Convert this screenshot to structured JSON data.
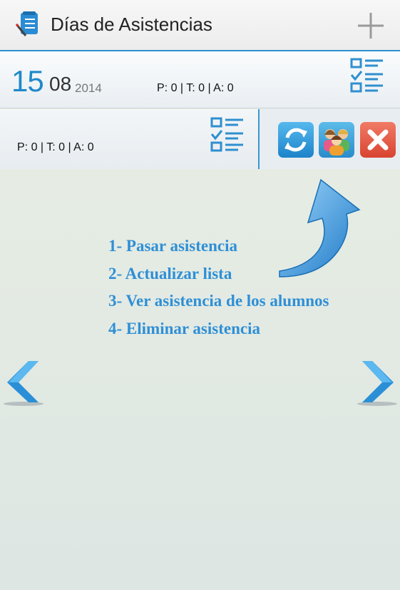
{
  "app": {
    "title": "Días de Asistencias"
  },
  "icons": {
    "app": "checklist-notepad-icon",
    "add": "plus-icon",
    "list": "checklist-icon",
    "refresh": "refresh-icon",
    "students": "students-group-icon",
    "delete": "close-icon",
    "prev": "chevron-left-icon",
    "next": "chevron-right-icon",
    "pointer": "curved-arrow-icon"
  },
  "attendance_days": [
    {
      "day": "15",
      "month": "08",
      "year": "2014",
      "stats": "P: 0 | T: 0 | A: 0"
    },
    {
      "stats": "P: 0 | T: 0 | A: 0"
    }
  ],
  "instructions": [
    "1- Pasar asistencia",
    "2- Actualizar lista",
    "3- Ver asistencia de los alumnos",
    "4- Eliminar asistencia"
  ],
  "colors": {
    "accent": "#2f8fd6",
    "delete": "#e05a44"
  }
}
